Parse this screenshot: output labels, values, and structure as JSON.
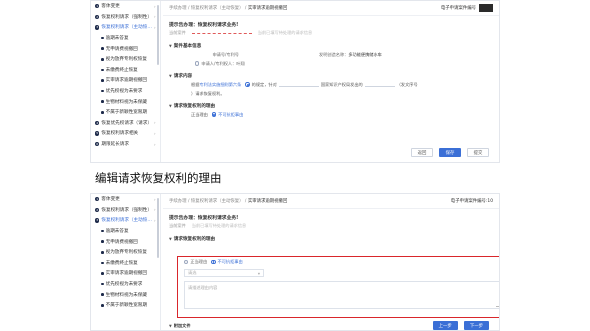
{
  "sidebar": {
    "items": [
      {
        "num": "1",
        "label": "客体变更",
        "sub": false,
        "active": false,
        "chev": true
      },
      {
        "num": "2",
        "label": "恢复权利请求（强制性）",
        "sub": false,
        "active": false,
        "chev": true
      },
      {
        "num": "3",
        "label": "恢复权利请求（主动恢复）",
        "sub": false,
        "active": true,
        "chev": true
      },
      {
        "num": "",
        "label": "逾期未答复",
        "sub": true,
        "active": false,
        "chev": false
      },
      {
        "num": "",
        "label": "无申请费视撤回",
        "sub": true,
        "active": false,
        "chev": false
      },
      {
        "num": "",
        "label": "视为放弃专利权恢复",
        "sub": true,
        "active": false,
        "chev": false
      },
      {
        "num": "",
        "label": "未缴费终止恢复",
        "sub": true,
        "active": false,
        "chev": false
      },
      {
        "num": "",
        "label": "实审请求逾期视撤回",
        "sub": true,
        "active": false,
        "chev": false
      },
      {
        "num": "",
        "label": "优先权视为未要求",
        "sub": true,
        "active": false,
        "chev": false
      },
      {
        "num": "",
        "label": "生物材料视为未保藏",
        "sub": true,
        "active": false,
        "chev": false
      },
      {
        "num": "",
        "label": "不属于新颖性宽限期",
        "sub": true,
        "active": false,
        "chev": false
      },
      {
        "num": "4",
        "label": "恢复优先权请求（请求）",
        "sub": false,
        "active": false,
        "chev": true
      },
      {
        "num": "5",
        "label": "恢复权利请求相关",
        "sub": false,
        "active": false,
        "chev": true
      },
      {
        "num": "6",
        "label": "期限延长请求",
        "sub": false,
        "active": false,
        "chev": true
      }
    ],
    "items2": [
      {
        "num": "1",
        "label": "客体变更",
        "sub": false,
        "active": false,
        "chev": true
      },
      {
        "num": "2",
        "label": "恢复权利请求（强制性）",
        "sub": false,
        "active": false,
        "chev": true
      },
      {
        "num": "3",
        "label": "恢复权利请求（主动恢复）",
        "sub": false,
        "active": true,
        "chev": true
      },
      {
        "num": "",
        "label": "逾期未答复",
        "sub": true,
        "active": false,
        "chev": false
      },
      {
        "num": "",
        "label": "无申请费视撤回",
        "sub": true,
        "active": false,
        "chev": false
      },
      {
        "num": "",
        "label": "视为放弃专利权恢复",
        "sub": true,
        "active": false,
        "chev": false
      },
      {
        "num": "",
        "label": "未缴费终止恢复",
        "sub": true,
        "active": false,
        "chev": false
      },
      {
        "num": "",
        "label": "实审请求逾期视撤回",
        "sub": true,
        "active": false,
        "chev": false
      },
      {
        "num": "",
        "label": "优先权视为未要求",
        "sub": true,
        "active": false,
        "chev": false
      },
      {
        "num": "",
        "label": "生物材料视为未保藏",
        "sub": true,
        "active": false,
        "chev": false
      },
      {
        "num": "",
        "label": "不属于新颖性宽限期",
        "sub": true,
        "active": false,
        "chev": false
      }
    ]
  },
  "topbar": {
    "crumb_prefix": "手续办理 / 恢复权利请求（主动恢复） /",
    "crumb_current": "实审请求逾期视撤回",
    "crumb2_prefix": "手续办理 / 恢复权利请求（主动恢复） /",
    "crumb2_current": "实审请求逾期视撤回",
    "user_label": "电子申请案件编号",
    "user_label2": "电子申请案件编号:10"
  },
  "notice": {
    "title": "提示告办理：恢复权利请求业务!",
    "sub_label": "当前案件",
    "sub_placeholder": "当前已填写待处理的请求信息"
  },
  "basic": {
    "heading": "案件基本信息",
    "app_no_label": "申请号/专利号",
    "app_name_label": "发明创造名称：",
    "app_name_value": "多功能便携储水车",
    "applicant_label": "申请人/专利权人：叶翔"
  },
  "request": {
    "heading": "请求内容",
    "line_pre": "根据",
    "line_link": "专利法实施细则第六条",
    "line_mid": "的规定，针对",
    "line_mid2": "国家知识产权局发出的",
    "line_end": "（发文序号",
    "line2": "）请求恢复权利。"
  },
  "reason": {
    "heading": "请求恢复权利的理由",
    "opt1": "正当理由",
    "opt2": "不可抗拒事由"
  },
  "buttons": {
    "back": "返回",
    "save": "保存",
    "submit": "提交"
  },
  "caption": "编辑请求恢复权利的理由",
  "edit": {
    "heading": "请求恢复权利的理由",
    "opt1": "正当理由",
    "opt2": "不可抗拒事由",
    "select_placeholder": "请选",
    "text_placeholder": "请描述理由内容"
  },
  "bottom": {
    "section": "附加文件",
    "btn_left": "上一步",
    "btn_right": "下一步"
  }
}
